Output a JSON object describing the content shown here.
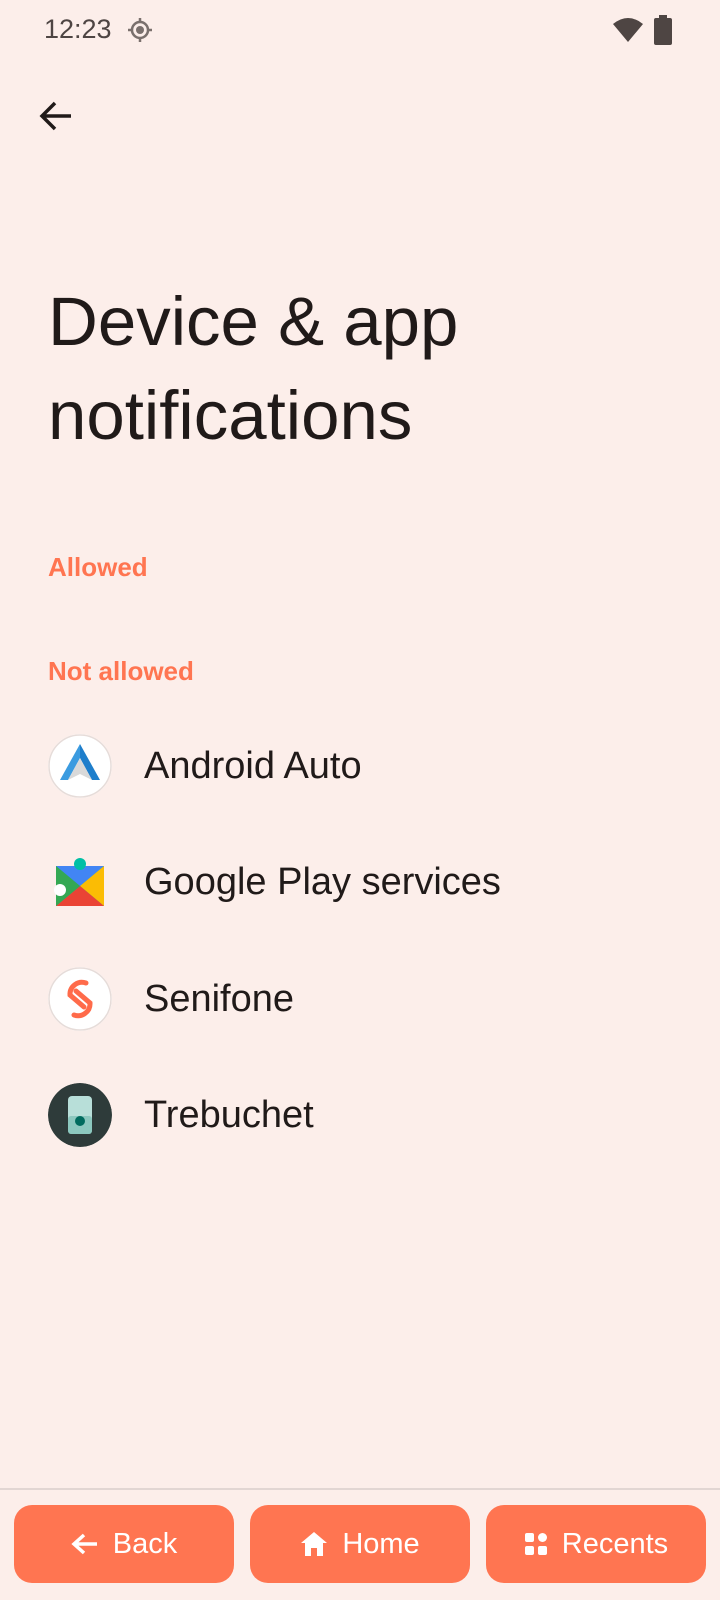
{
  "status_bar": {
    "time": "12:23",
    "icons": [
      "location-icon",
      "wifi-icon",
      "battery-icon"
    ]
  },
  "header": {
    "back_icon": "arrow-left-icon",
    "title": "Device & app notifications"
  },
  "sections": {
    "allowed": "Allowed",
    "not_allowed": "Not allowed"
  },
  "apps": [
    {
      "label": "Android Auto",
      "icon": "android-auto-icon"
    },
    {
      "label": "Google Play services",
      "icon": "google-play-services-icon"
    },
    {
      "label": "Senifone",
      "icon": "senifone-icon"
    },
    {
      "label": "Trebuchet",
      "icon": "trebuchet-icon"
    }
  ],
  "nav": {
    "back": "Back",
    "home": "Home",
    "recents": "Recents"
  },
  "colors": {
    "background": "#FCEEEA",
    "accent": "#FF7551",
    "text": "#201A19"
  }
}
